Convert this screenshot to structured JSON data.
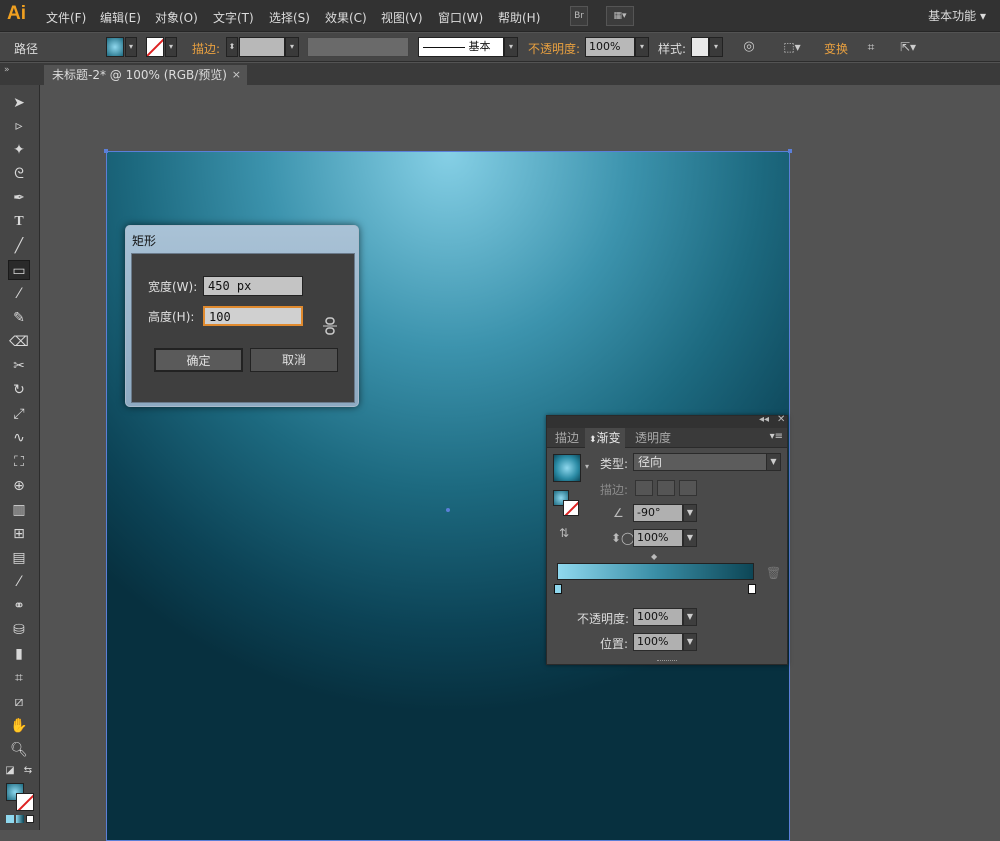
{
  "app": {
    "logo": "Ai",
    "menu": [
      "文件(F)",
      "编辑(E)",
      "对象(O)",
      "文字(T)",
      "选择(S)",
      "效果(C)",
      "视图(V)",
      "窗口(W)",
      "帮助(H)"
    ],
    "bridge_label": "Br",
    "workspace_label": "基本功能"
  },
  "control_bar": {
    "selection_label": "路径",
    "stroke_label": "描边:",
    "stroke_style_label": "基本",
    "opacity_label": "不透明度:",
    "opacity_value": "100%",
    "style_label": "样式:",
    "transform_label": "变换"
  },
  "document_tab": {
    "title": "未标题-2* @ 100% (RGB/预览)",
    "close": "×"
  },
  "rect_dialog": {
    "title": "矩形",
    "width_label": "宽度(W):",
    "width_value": "450 px",
    "height_label": "高度(H):",
    "height_value": "100",
    "ok_label": "确定",
    "cancel_label": "取消"
  },
  "gradient_panel": {
    "tabs": [
      "描边",
      "渐变",
      "透明度"
    ],
    "active_tab": "渐变",
    "type_label": "类型:",
    "type_value": "径向",
    "stroke_label": "描边:",
    "angle_value": "-90°",
    "aspect_value": "100%",
    "opacity_label": "不透明度:",
    "opacity_value": "100%",
    "location_label": "位置:",
    "location_value": "100%"
  },
  "colors": {
    "accent": "#e8a040",
    "artboard_border": "#5b7fd8",
    "gradient_start": "#8fd8ee",
    "gradient_end": "#0d4656"
  }
}
